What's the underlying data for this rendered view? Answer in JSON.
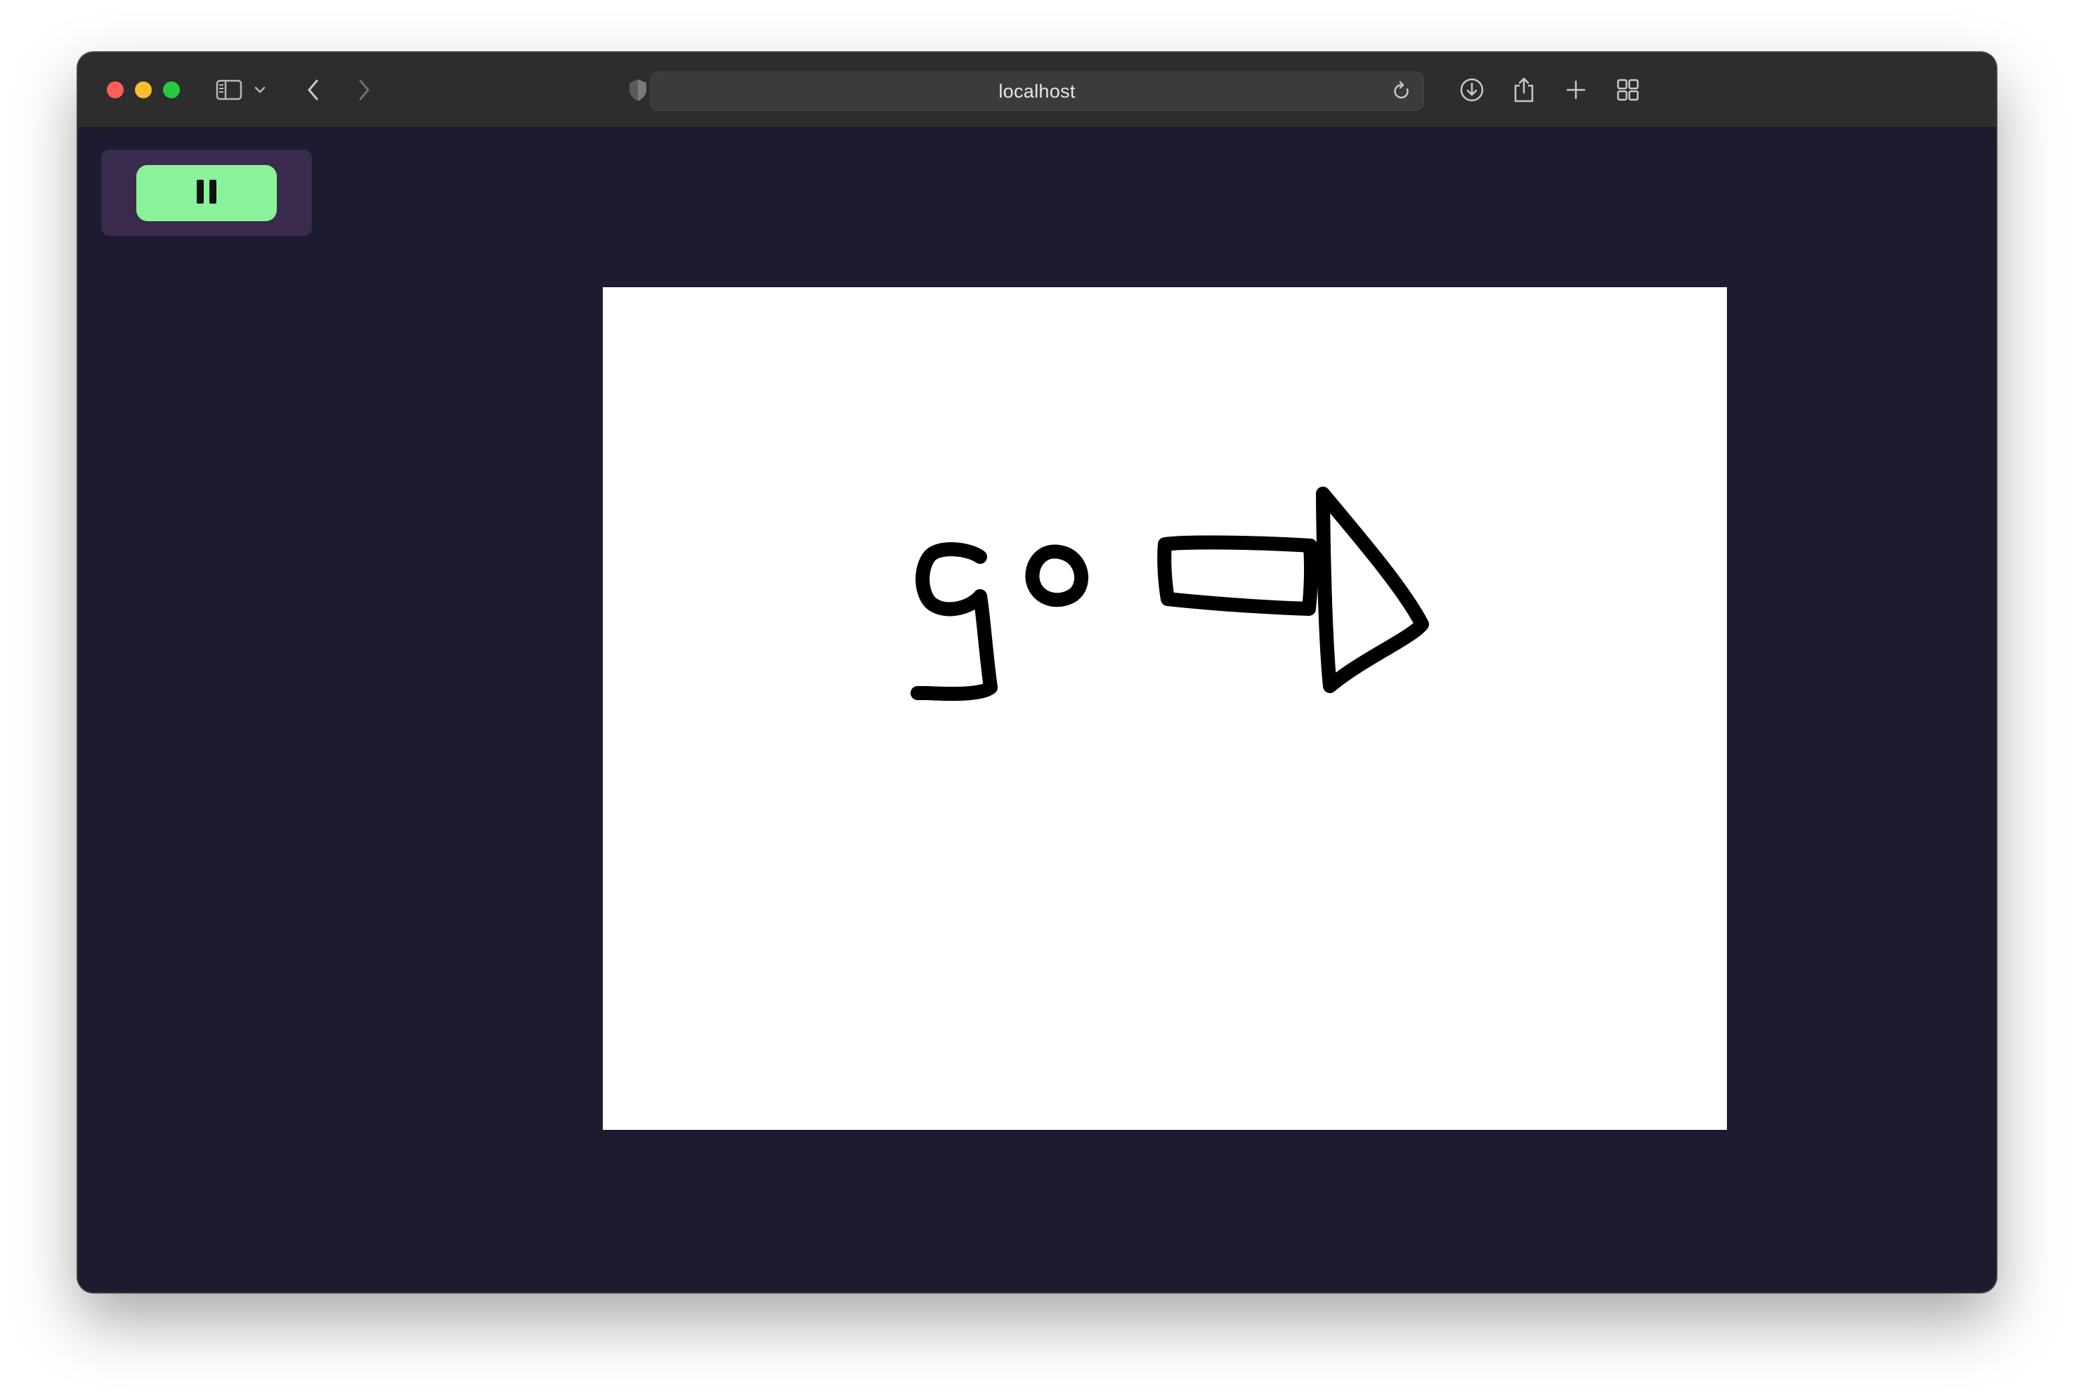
{
  "browser": {
    "url": "localhost",
    "icons": {
      "sidebar": "sidebar-icon",
      "sidebar_menu": "chevron-down-icon",
      "back": "chevron-left-icon",
      "forward": "chevron-right-icon",
      "privacy": "shield-icon",
      "extensions": "grid-dots-icon",
      "reload": "reload-icon",
      "downloads": "download-icon",
      "share": "share-icon",
      "new_tab": "plus-icon",
      "tab_overview": "tab-overview-icon"
    },
    "traffic_lights": {
      "close": "#ff5f57",
      "minimize": "#febc2e",
      "zoom": "#28c840"
    }
  },
  "page": {
    "background_color": "#1d1b30",
    "panel_color": "#3a2a4d",
    "pause_button": {
      "icon": "pause-icon",
      "color": "#8af29a"
    },
    "canvas": {
      "background": "#ffffff",
      "drawing": "hand-drawn-sketch"
    }
  }
}
